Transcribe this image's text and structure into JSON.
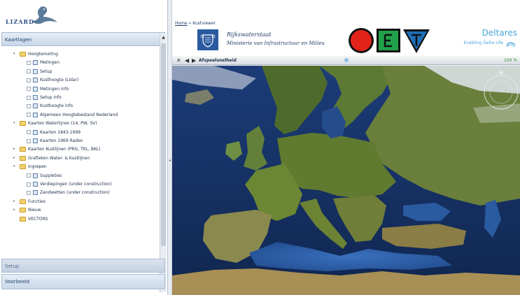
{
  "app": {
    "logo_text": "LIZARD"
  },
  "left_panel": {
    "layers_header": "Kaartlagen",
    "setup_header": "Setup",
    "voorbeeld_header": "Voorbeeld",
    "tree": [
      {
        "kind": "folder",
        "label": "Hoogtemeting",
        "expanded": true
      },
      {
        "kind": "leaf",
        "label": "Metingen"
      },
      {
        "kind": "leaf",
        "label": "Setup"
      },
      {
        "kind": "leaf",
        "label": "Kusthoogte (Lidar)"
      },
      {
        "kind": "leaf",
        "label": "Metingen info"
      },
      {
        "kind": "leaf",
        "label": "Setup info"
      },
      {
        "kind": "leaf",
        "label": "Kusthoogte info"
      },
      {
        "kind": "leaf",
        "label": "Algemeen Hoogtebestand Nederland"
      },
      {
        "kind": "folder",
        "label": "Kaarten Waterlijnen (14, PW, SV)",
        "expanded": true
      },
      {
        "kind": "leaf",
        "label": "Kaarten 1843-1999"
      },
      {
        "kind": "leaf",
        "label": "Kaarten 1969 Raden"
      },
      {
        "kind": "folder",
        "label": "Kaarten Kustlijnen (PRG, TKL, BKL)",
        "expanded": false
      },
      {
        "kind": "folder",
        "label": "Grafieken Water- & Kustlijnen",
        "expanded": false
      },
      {
        "kind": "folder",
        "label": "Ingrepen",
        "expanded": true
      },
      {
        "kind": "leaf",
        "label": "Suppleties"
      },
      {
        "kind": "leaf",
        "label": "Verdiepingen (under construction)"
      },
      {
        "kind": "leaf",
        "label": "Zandwetten (under construction)"
      },
      {
        "kind": "folder",
        "label": "Functies",
        "expanded": false
      },
      {
        "kind": "folder",
        "label": "Nieuw",
        "expanded": false
      },
      {
        "kind": "folder-plain",
        "label": "VECTORS"
      }
    ]
  },
  "header": {
    "breadcrumb_home": "Home",
    "breadcrumb_sep": "»",
    "breadcrumb_current": "Kustviewer",
    "ministry_name": "Rijkswaterstaat",
    "ministry_sub": "Ministerie van Infrastructuur en Milieu",
    "partner_name": "Deltares",
    "partner_tagline": "Enabling Delta Life"
  },
  "toolbar": {
    "close_glyph": "✕",
    "back_glyph": "◀",
    "forward_glyph": "▶",
    "label": "Afspeelsnelheid",
    "zoom": "100 %"
  },
  "colors": {
    "panel_header": "#c9d7e8",
    "link": "#20406a",
    "deltares_blue": "#4aa6d8",
    "sea_dark": "#122a5a",
    "sea_mid": "#2d5da6",
    "land": "#5a7a2a"
  },
  "icons": [
    "close-icon",
    "back-icon",
    "forward-icon",
    "folder-icon",
    "layer-icon",
    "checkbox",
    "scroll-up-icon",
    "scroll-down-icon",
    "globe-navigation-icon",
    "stop-sign-icon",
    "square-sign-icon",
    "triangle-sign-icon",
    "delta-wave-icon"
  ]
}
